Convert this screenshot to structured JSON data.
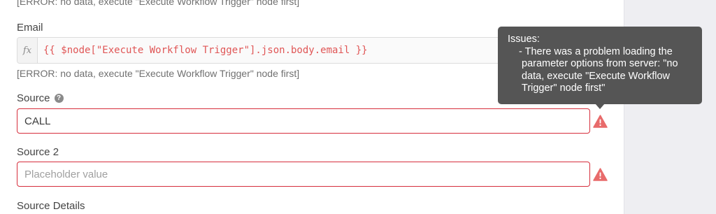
{
  "colors": {
    "error_border": "#d62e3c",
    "warning_icon": "#e86b6b",
    "tooltip_bg": "#555555",
    "expression_text": "#e05656"
  },
  "top_hint": "[ERROR: no data, execute \"Execute Workflow Trigger\" node first]",
  "email": {
    "label": "Email",
    "fx_symbol": "fx",
    "expression": "{{ $node[\"Execute Workflow Trigger\"].json.body.email }}",
    "hint": "[ERROR: no data, execute \"Execute Workflow Trigger\" node first]"
  },
  "source": {
    "label": "Source",
    "help_icon": "question-circle-icon",
    "help_glyph": "?",
    "value": "CALL",
    "warning_icon": "warning-triangle-icon"
  },
  "source2": {
    "label": "Source 2",
    "placeholder": "Placeholder value",
    "warning_icon": "warning-triangle-icon"
  },
  "source_details": {
    "label": "Source Details"
  },
  "tooltip": {
    "title": "Issues:",
    "line1": "- There was a problem loading the",
    "line2": "parameter options from server: \"no",
    "line3": "data, execute \"Execute Workflow",
    "line4": "Trigger\" node first\""
  }
}
